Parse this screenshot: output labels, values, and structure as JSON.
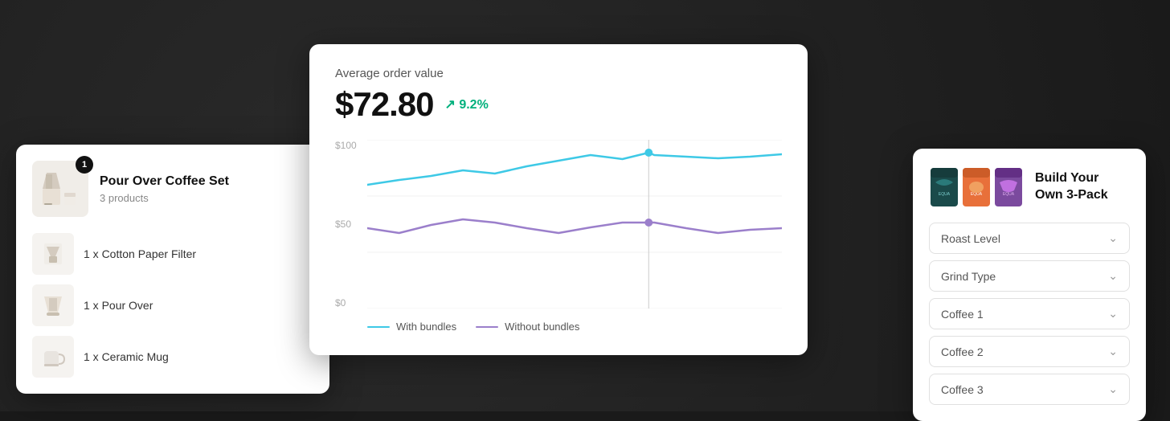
{
  "background": {
    "color": "#1a1a1a"
  },
  "cart_card": {
    "badge": "1",
    "title": "Pour Over Coffee Set",
    "subtitle": "3 products",
    "items": [
      {
        "label": "1 x Cotton Paper Filter",
        "icon": "filter"
      },
      {
        "label": "1 x Pour Over",
        "icon": "pourover"
      },
      {
        "label": "1 x Ceramic Mug",
        "icon": "mug"
      }
    ]
  },
  "analytics_card": {
    "label": "Average order value",
    "value": "$72.80",
    "change": "↗ 9.2%",
    "y_labels": [
      "$100",
      "$50",
      "$0"
    ],
    "legend": [
      {
        "label": "With bundles",
        "color": "#3ec9e6"
      },
      {
        "label": "Without bundles",
        "color": "#9b7fcb"
      }
    ],
    "chart": {
      "with_bundles": [
        68,
        72,
        75,
        78,
        76,
        80,
        83,
        86,
        84,
        87,
        86,
        85,
        87
      ],
      "without_bundles": [
        36,
        34,
        38,
        42,
        40,
        38,
        36,
        38,
        42,
        40,
        38,
        36,
        38
      ],
      "cursor_x_pct": 0.68
    }
  },
  "build_card": {
    "title": "Build Your Own 3-Pack",
    "dropdowns": [
      {
        "label": "Roast Level"
      },
      {
        "label": "Grind Type"
      },
      {
        "label": "Coffee 1"
      },
      {
        "label": "Coffee 2"
      },
      {
        "label": "Coffee 3"
      }
    ]
  }
}
